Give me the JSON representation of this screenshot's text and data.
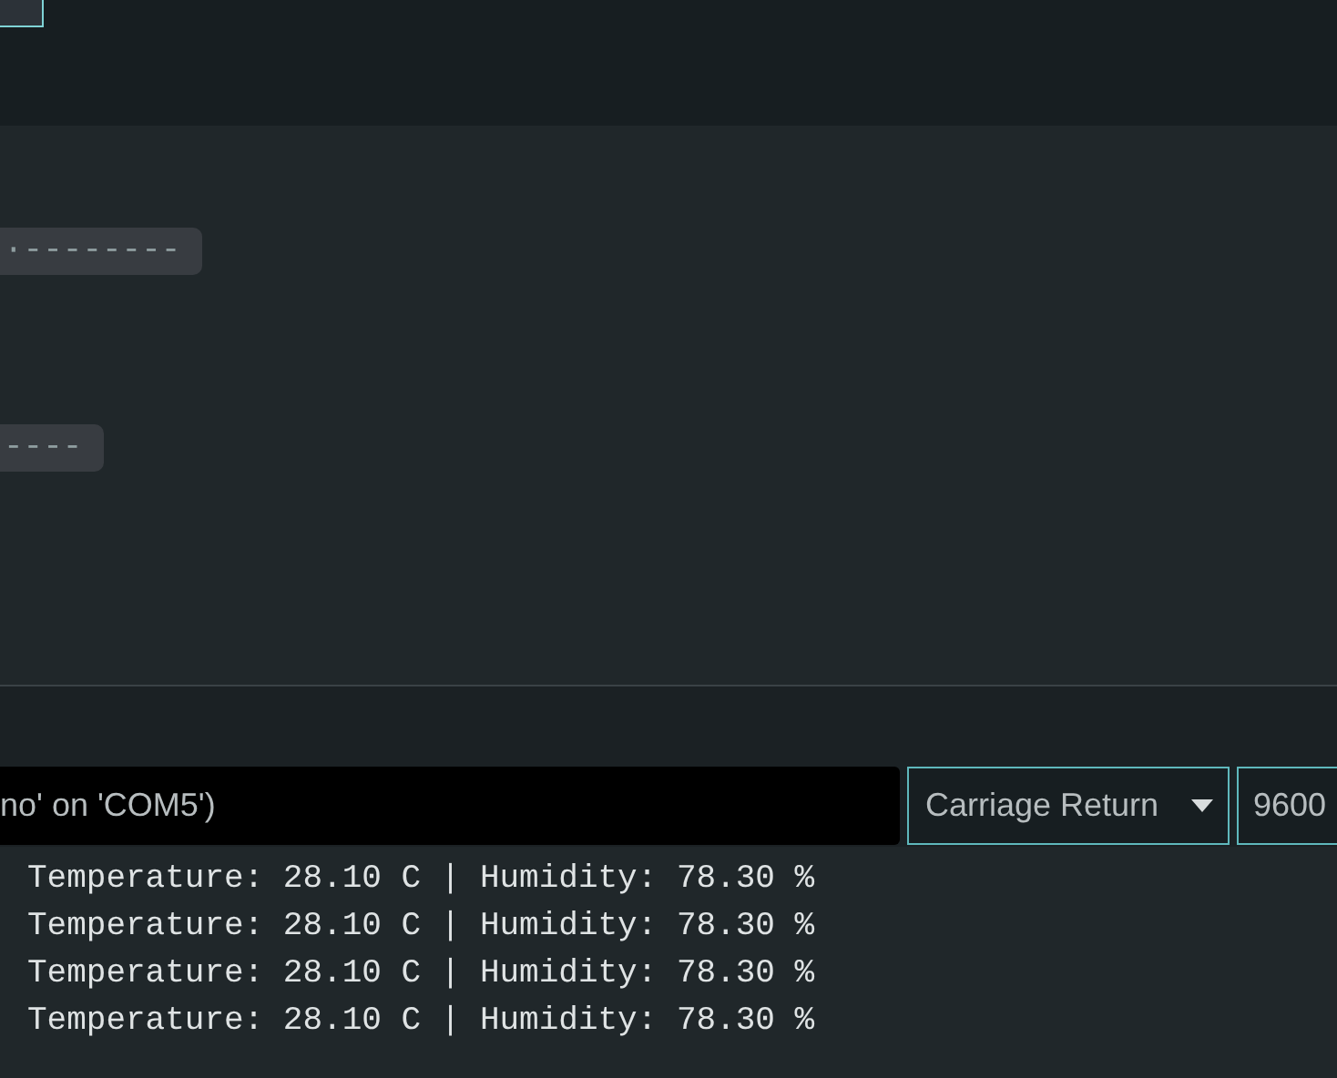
{
  "code_chips": [
    "·--------",
    "----"
  ],
  "message_field": {
    "value": "no' on 'COM5')"
  },
  "line_ending": {
    "value": "Carriage Return"
  },
  "baud_rate": {
    "value": "9600"
  },
  "output_lines": [
    "Temperature: 28.10 C | Humidity: 78.30 %",
    "Temperature: 28.10 C | Humidity: 78.30 %",
    "Temperature: 28.10 C | Humidity: 78.30 %",
    "Temperature: 28.10 C | Humidity: 78.30 %"
  ]
}
